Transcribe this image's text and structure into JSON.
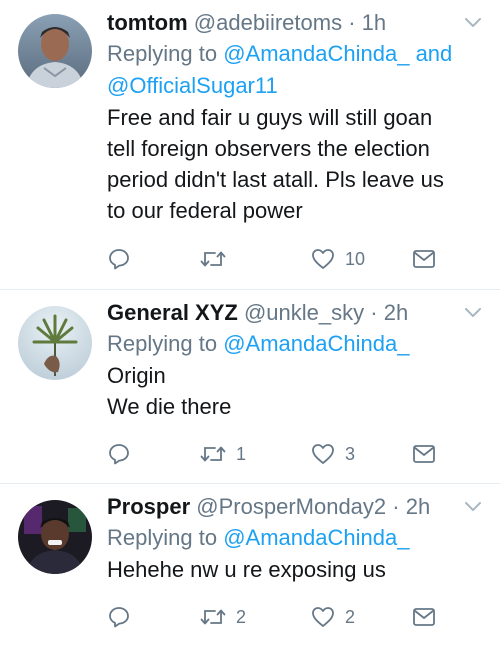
{
  "tweets": [
    {
      "name": "tomtom",
      "handle": "@adebiiretoms",
      "separator": "·",
      "time": "1h",
      "replying_prefix": "Replying to",
      "replying_to_1": "@AmandaChinda_",
      "replying_joiner": "and",
      "replying_to_2": "@OfficialSugar11",
      "text_lines": [
        "Free and fair u guys will still goan",
        "tell foreign observers the election",
        "period didn't last atall. Pls leave us",
        "to our federal power"
      ],
      "retweets": "",
      "likes": "10"
    },
    {
      "name": "General XYZ",
      "handle": "@unkle_sky",
      "separator": "·",
      "time": "2h",
      "replying_prefix": "Replying to",
      "replying_to_1": "@AmandaChinda_",
      "text_lines": [
        "Origin",
        "We die there"
      ],
      "retweets": "1",
      "likes": "3"
    },
    {
      "name": "Prosper",
      "handle": "@ProsperMonday2",
      "separator": "·",
      "time": "2h",
      "replying_prefix": "Replying to",
      "replying_to_1": "@AmandaChinda_",
      "text_lines": [
        "Hehehe nw u re exposing us"
      ],
      "retweets": "2",
      "likes": "2"
    }
  ],
  "icons": {
    "reply": "reply-icon",
    "retweet": "retweet-icon",
    "like": "heart-icon",
    "dm": "envelope-icon",
    "more": "chevron-down-icon"
  },
  "colors": {
    "link": "#1da1f2",
    "muted": "#657786",
    "text": "#14171a",
    "divider": "#e6ecf0"
  }
}
